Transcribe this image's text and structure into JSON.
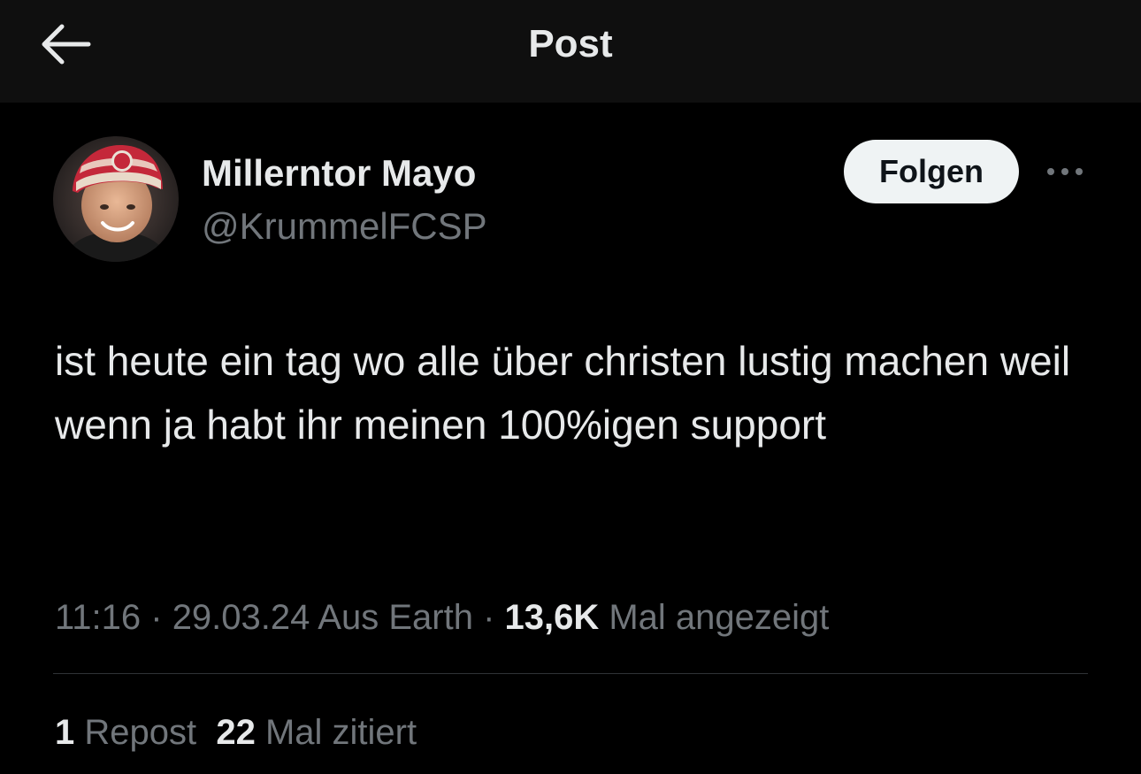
{
  "header": {
    "title": "Post",
    "back_icon": "arrow-left-icon"
  },
  "author": {
    "display_name": "Millerntor Mayo",
    "handle": "@KrummelFCSP",
    "avatar": "avatar-photo"
  },
  "actions": {
    "follow_label": "Folgen",
    "more_icon": "more-horizontal-icon"
  },
  "post": {
    "text": "ist heute ein tag wo alle über christen lustig machen weil wenn ja habt ihr meinen 100%igen support"
  },
  "meta": {
    "time": "11:16",
    "sep1": " · ",
    "date": "29.03.24",
    "source": " Aus Earth",
    "sep2": " · ",
    "views_count": "13,6K",
    "views_label": " Mal angezeigt"
  },
  "stats": {
    "reposts_count": "1",
    "reposts_label": " Repost",
    "quotes_count": "22",
    "quotes_label": " Mal zitiert"
  },
  "colors": {
    "background": "#000000",
    "header_bg": "#0f0f0f",
    "text_primary": "#e7e9ea",
    "text_secondary": "#71767b",
    "follow_button_bg": "#eff3f4",
    "divider": "#2f3336"
  }
}
